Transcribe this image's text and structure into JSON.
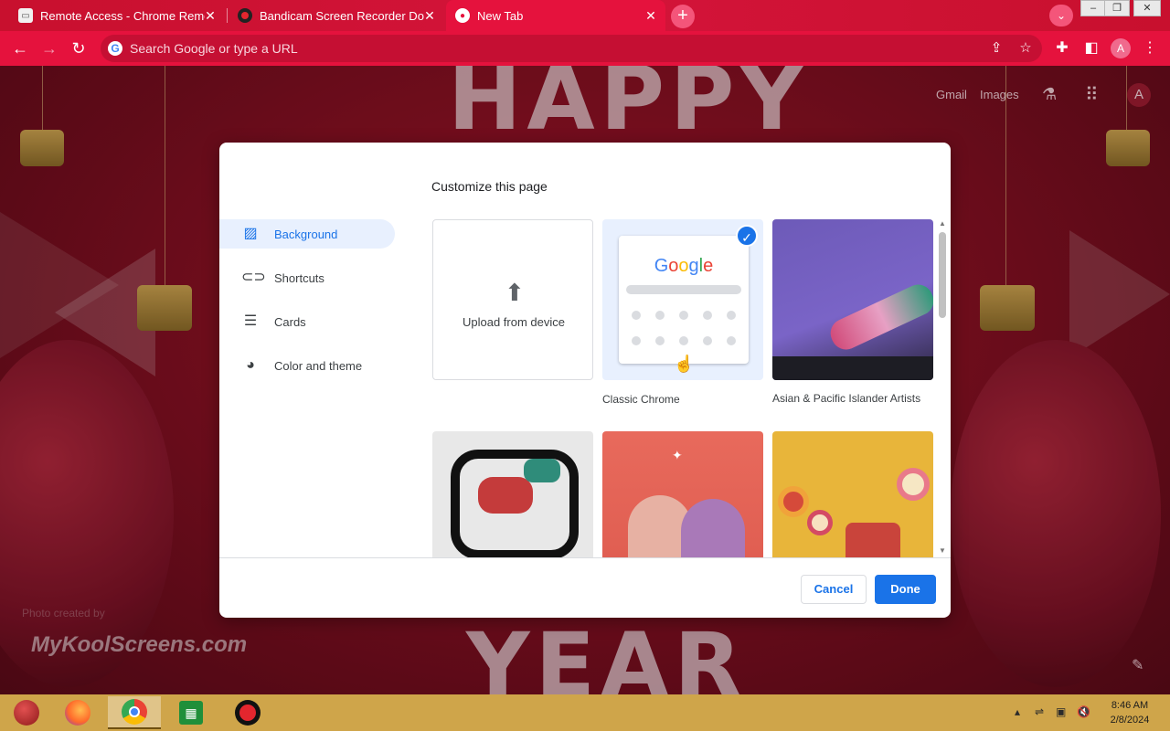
{
  "browser": {
    "tabs": [
      {
        "title": "Remote Access - Chrome Remote",
        "favicon": "remote-desktop-icon"
      },
      {
        "title": "Bandicam Screen Recorder Down",
        "favicon": "bandicam-icon"
      },
      {
        "title": "New Tab",
        "favicon": "chrome-icon",
        "active": true
      }
    ],
    "new_tab_symbol": "+",
    "omnibox": {
      "placeholder": "Search Google or type a URL"
    },
    "profile_initial": "A",
    "accent_color": "#e5123d"
  },
  "ntp": {
    "links": {
      "gmail": "Gmail",
      "images": "Images"
    },
    "avatar_initial": "A",
    "background_words": {
      "top": "HAPPY",
      "bottom": "YEAR"
    },
    "watermark": "MyKoolScreens.com",
    "attribution": "Photo created by"
  },
  "dialog": {
    "title": "Customize this page",
    "menu": [
      {
        "label": "Background",
        "icon": "image-icon",
        "selected": true
      },
      {
        "label": "Shortcuts",
        "icon": "link-icon"
      },
      {
        "label": "Cards",
        "icon": "cards-icon"
      },
      {
        "label": "Color and theme",
        "icon": "palette-icon"
      }
    ],
    "tiles": {
      "upload": {
        "label": "Upload from device"
      },
      "classic": {
        "label": "Classic Chrome",
        "logo": "Google",
        "selected": true
      },
      "aapi": {
        "label": "Asian & Pacific Islander Artists"
      }
    },
    "buttons": {
      "cancel": "Cancel",
      "done": "Done"
    },
    "primary_color": "#1a73e8"
  },
  "taskbar": {
    "apps": [
      "ornament-start-icon",
      "firefox-icon",
      "chrome-icon",
      "store-icon",
      "bandicam-record-icon"
    ],
    "clock": {
      "time": "8:46 AM",
      "date": "2/8/2024"
    }
  }
}
